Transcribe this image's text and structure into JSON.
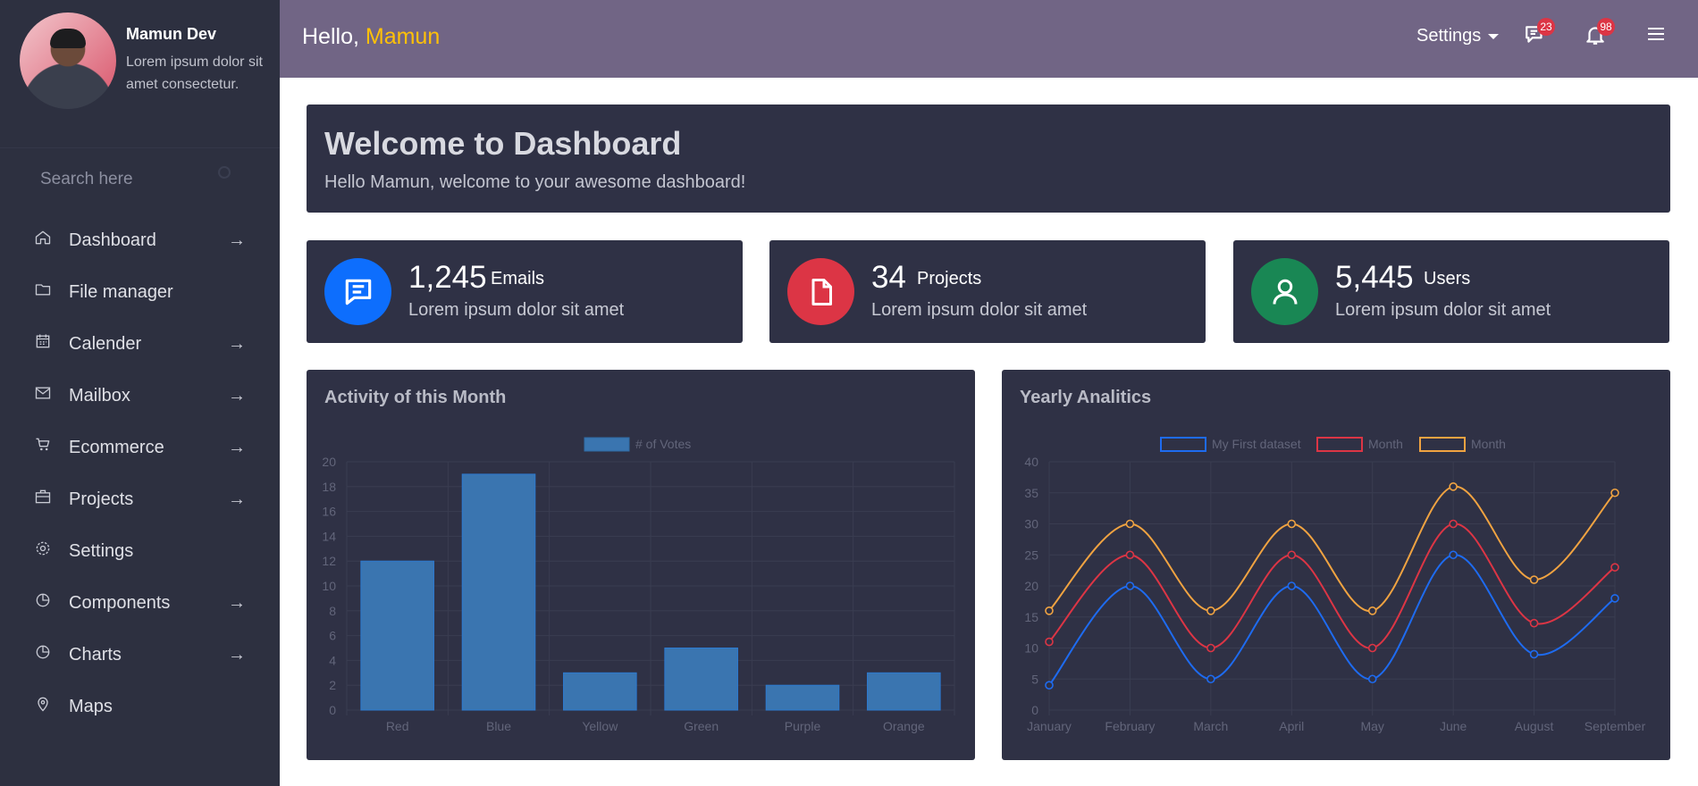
{
  "profile": {
    "name": "Mamun Dev",
    "description": "Lorem ipsum dolor sit amet consectetur."
  },
  "search": {
    "placeholder": "Search here"
  },
  "nav": [
    {
      "label": "Dashboard",
      "icon": "home-icon",
      "arrow": "→"
    },
    {
      "label": "File manager",
      "icon": "folder-icon",
      "arrow": ""
    },
    {
      "label": "Calender",
      "icon": "calendar-icon",
      "arrow": "→"
    },
    {
      "label": "Mailbox",
      "icon": "envelope-icon",
      "arrow": "→"
    },
    {
      "label": "Ecommerce",
      "icon": "cart-icon",
      "arrow": "→"
    },
    {
      "label": "Projects",
      "icon": "briefcase-icon",
      "arrow": "→"
    },
    {
      "label": "Settings",
      "icon": "gear-icon",
      "arrow": ""
    },
    {
      "label": "Components",
      "icon": "pie-icon",
      "arrow": "→"
    },
    {
      "label": "Charts",
      "icon": "pie-icon",
      "arrow": "→"
    },
    {
      "label": "Maps",
      "icon": "map-pin-icon",
      "arrow": ""
    }
  ],
  "header": {
    "greeting": "Hello,",
    "user": "Mamun",
    "settings_label": "Settings",
    "messages_count": "23",
    "notifications_count": "98",
    "background": "#716585",
    "accent": "#ffc107"
  },
  "welcome": {
    "title": "Welcome to Dashboard",
    "subtitle": "Hello Mamun, welcome to your awesome dashboard!"
  },
  "stats": [
    {
      "value": "1,245",
      "label": "Emails",
      "sub": "Lorem ipsum dolor sit amet",
      "color": "#0d6efd",
      "icon": "message-icon"
    },
    {
      "value": "34",
      "label": "Projects",
      "sub": "Lorem ipsum dolor sit amet",
      "color": "#dc3545",
      "icon": "file-icon"
    },
    {
      "value": "5,445",
      "label": "Users",
      "sub": "Lorem ipsum dolor sit amet",
      "color": "#198754",
      "icon": "user-icon"
    }
  ],
  "chart_data": [
    {
      "type": "bar",
      "title": "Activity of this Month",
      "categories": [
        "Red",
        "Blue",
        "Yellow",
        "Green",
        "Purple",
        "Orange"
      ],
      "series": [
        {
          "name": "# of Votes",
          "values": [
            12,
            19,
            3,
            5,
            2,
            3
          ],
          "color": "#3a75b0"
        }
      ],
      "ylim": [
        0,
        20
      ],
      "yticks": [
        0,
        2,
        4,
        6,
        8,
        10,
        12,
        14,
        16,
        18,
        20
      ],
      "grid": true,
      "legend": "top"
    },
    {
      "type": "line",
      "title": "Yearly Analitics",
      "categories": [
        "January",
        "February",
        "March",
        "April",
        "May",
        "June",
        "August",
        "September"
      ],
      "series": [
        {
          "name": "My First dataset",
          "values": [
            4,
            20,
            5,
            20,
            5,
            25,
            9,
            18
          ],
          "color": "#1e6bf0"
        },
        {
          "name": "Month",
          "values": [
            11,
            25,
            10,
            25,
            10,
            30,
            14,
            23
          ],
          "color": "#dc3545"
        },
        {
          "name": "Month",
          "values": [
            16,
            30,
            16,
            30,
            16,
            36,
            21,
            35
          ],
          "color": "#f0a341"
        }
      ],
      "ylim": [
        0,
        40
      ],
      "yticks": [
        0,
        5,
        10,
        15,
        20,
        25,
        30,
        35,
        40
      ],
      "grid": true,
      "legend": "top"
    }
  ]
}
